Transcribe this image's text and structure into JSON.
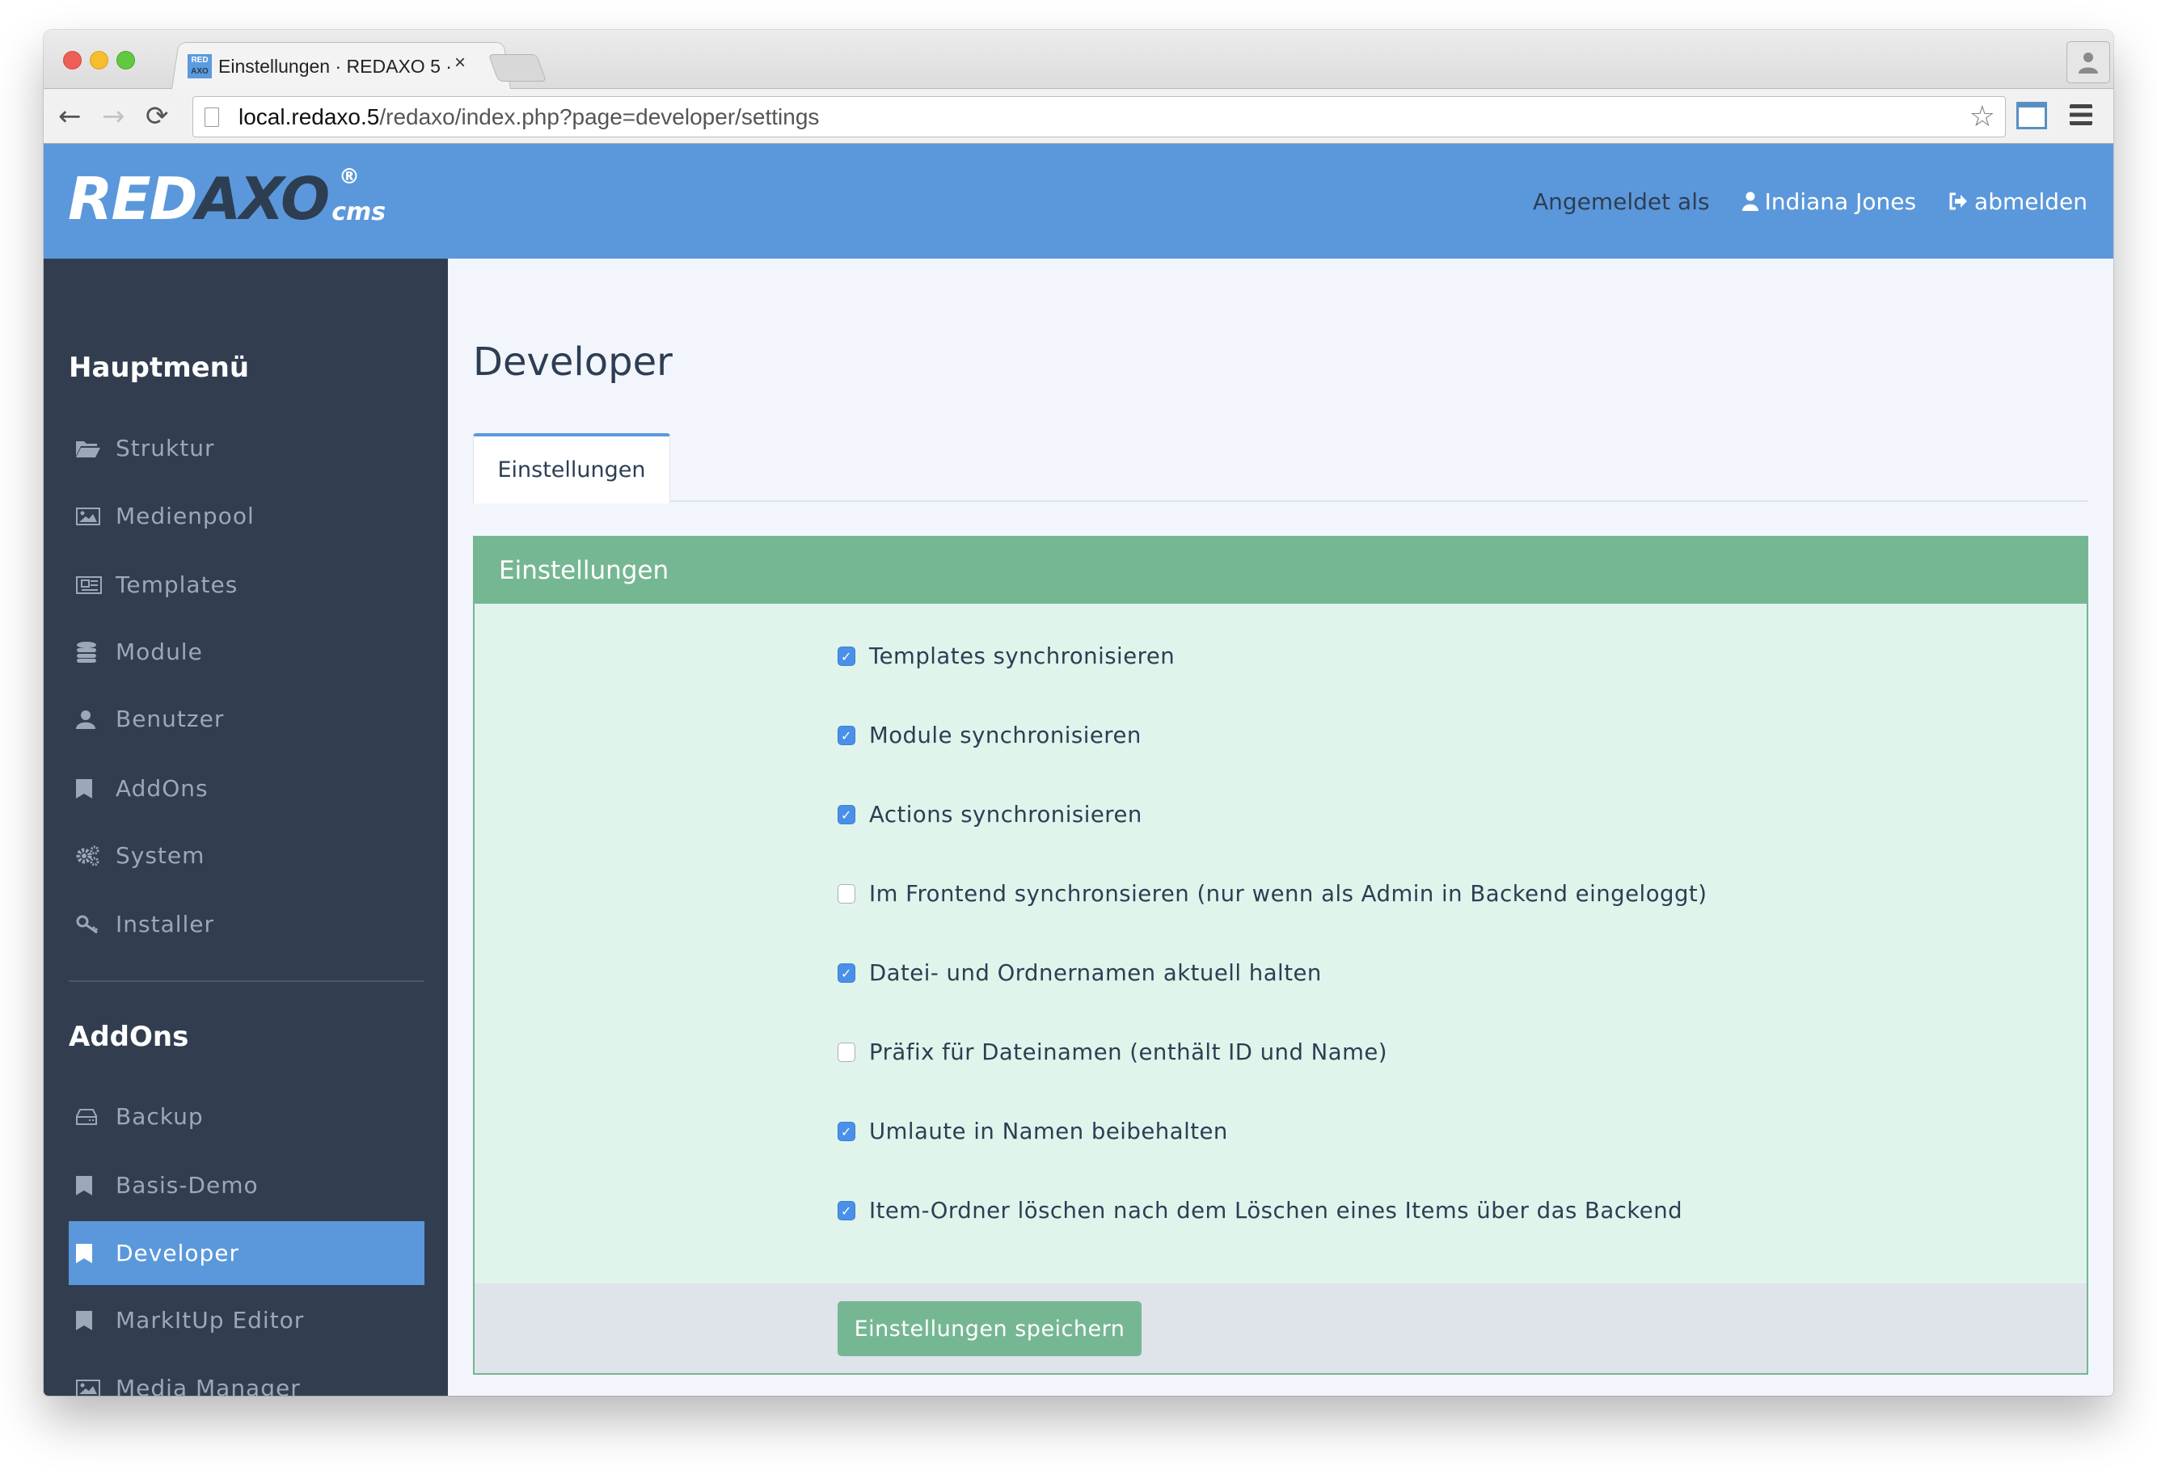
{
  "browser": {
    "tab_title": "Einstellungen · REDAXO 5 ·",
    "favicon_top": "RED",
    "favicon_bottom": "AXO",
    "close_glyph": "×",
    "url_host": "local.redaxo.5",
    "url_path": "/redaxo/index.php?page=developer/settings",
    "icons": {
      "back": "arrow-left-icon",
      "forward": "arrow-right-icon",
      "reload": "reload-icon",
      "bookmark": "star-icon",
      "cast": "cast-icon",
      "menu": "hamburger-menu-icon",
      "profile": "person-icon"
    }
  },
  "header": {
    "logo_red": "RED",
    "logo_axo": "AXO",
    "logo_cms": "cms",
    "logo_reg": "®",
    "logged_in_label": "Angemeldet als",
    "user_name": "Indiana Jones",
    "logout_label": "abmelden",
    "colors": {
      "brand": "#5b98db",
      "dark": "#2d3e53"
    }
  },
  "sidebar": {
    "main_heading": "Hauptmenü",
    "main_items": [
      {
        "label": "Struktur",
        "icon": "folder-open-icon"
      },
      {
        "label": "Medienpool",
        "icon": "image-icon"
      },
      {
        "label": "Templates",
        "icon": "newspaper-icon"
      },
      {
        "label": "Module",
        "icon": "database-icon"
      },
      {
        "label": "Benutzer",
        "icon": "user-icon"
      },
      {
        "label": "AddOns",
        "icon": "bookmark-icon"
      },
      {
        "label": "System",
        "icon": "gears-icon"
      },
      {
        "label": "Installer",
        "icon": "key-icon"
      }
    ],
    "addons_heading": "AddOns",
    "addon_items": [
      {
        "label": "Backup",
        "icon": "hdd-icon",
        "active": false
      },
      {
        "label": "Basis-Demo",
        "icon": "bookmark-icon",
        "active": false
      },
      {
        "label": "Developer",
        "icon": "bookmark-icon",
        "active": true
      },
      {
        "label": "MarkItUp Editor",
        "icon": "bookmark-icon",
        "active": false
      },
      {
        "label": "Media Manager",
        "icon": "image-icon",
        "active": false
      }
    ]
  },
  "main": {
    "page_title": "Developer",
    "tabs": [
      {
        "label": "Einstellungen",
        "active": true
      }
    ],
    "panel": {
      "title": "Einstellungen",
      "options": [
        {
          "label": "Templates synchronisieren",
          "checked": true
        },
        {
          "label": "Module synchronisieren",
          "checked": true
        },
        {
          "label": "Actions synchronisieren",
          "checked": true
        },
        {
          "label": "Im Frontend synchronsieren (nur wenn als Admin in Backend eingeloggt)",
          "checked": false
        },
        {
          "label": "Datei- und Ordnernamen aktuell halten",
          "checked": true
        },
        {
          "label": "Präfix für Dateinamen (enthält ID und Name)",
          "checked": false
        },
        {
          "label": "Umlaute in Namen beibehalten",
          "checked": true
        },
        {
          "label": "Item-Ordner löschen nach dem Löschen eines Items über das Backend",
          "checked": true
        }
      ],
      "save_label": "Einstellungen speichern",
      "check_glyph": "✓"
    }
  }
}
